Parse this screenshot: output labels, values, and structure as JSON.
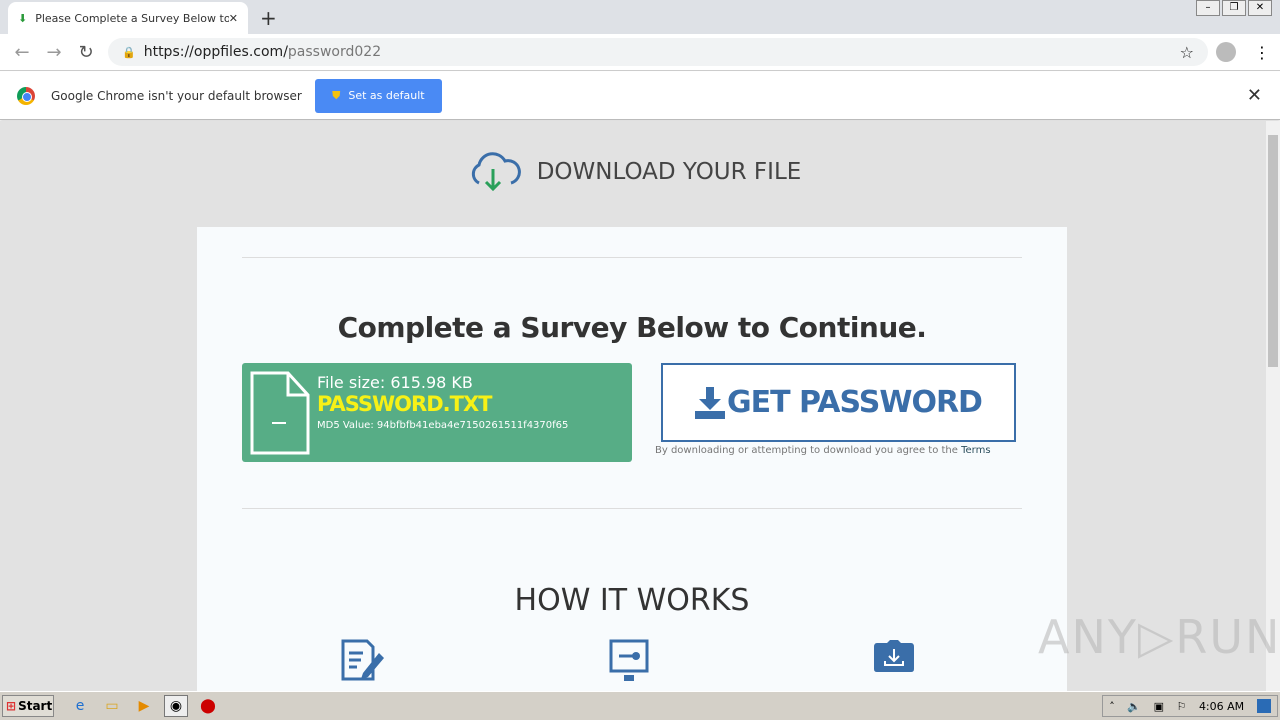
{
  "browser": {
    "tab_title": "Please Complete a Survey Below to Continue.",
    "url_host": "https://oppfiles.com/",
    "url_path": "password022"
  },
  "infobar": {
    "message": "Google Chrome isn't your default browser",
    "button": "Set as default"
  },
  "page": {
    "header": "DOWNLOAD YOUR FILE",
    "title": "Complete a Survey Below to Continue.",
    "file_size": "File size: 615.98 KB",
    "file_name": "PASSWORD.TXT",
    "md5": "MD5 Value: 94bfbfb41eba4e7150261511f4370f65",
    "get_password": "GET PASSWORD",
    "terms_text": "By downloading or attempting to download you agree to the ",
    "terms_link": "Terms",
    "how_title": "HOW IT WORKS"
  },
  "taskbar": {
    "start": "Start",
    "time": "4:06 AM"
  },
  "watermark": "ANY RUN",
  "colors": {
    "green": "#57ad86",
    "blue": "#3a6ea9",
    "yellow": "#f7f116"
  }
}
